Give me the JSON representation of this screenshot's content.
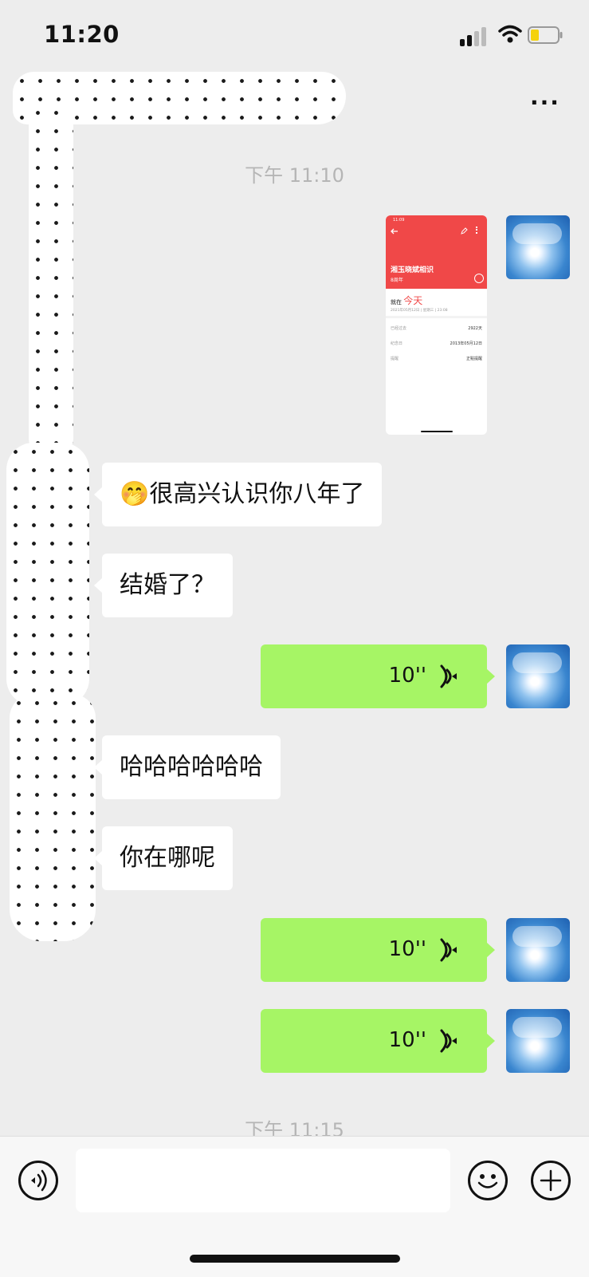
{
  "status_bar": {
    "time": "11:20"
  },
  "header": {
    "more_label": "···"
  },
  "timestamps": [
    "下午 11:10",
    "下午 11:15"
  ],
  "shared_card": {
    "status_time": "11:09",
    "title": "湘玉晓斌相识",
    "subtitle": "8周年",
    "today_prefix": "就在",
    "today_word": "今天",
    "date_line": "2021年05月12日 | 星期三 | 23:08",
    "rows": [
      {
        "label": "已经过去",
        "value": "2922天"
      },
      {
        "label": "纪念日",
        "value": "2013年05月12日"
      },
      {
        "label": "提醒",
        "value": "正點提醒"
      }
    ]
  },
  "messages": [
    {
      "side": "left",
      "type": "text",
      "emoji": "🤭",
      "text": "很高兴认识你八年了"
    },
    {
      "side": "left",
      "type": "text",
      "text": "结婚了？"
    },
    {
      "side": "right",
      "type": "voice",
      "duration": "10''"
    },
    {
      "side": "left",
      "type": "text",
      "text": "哈哈哈哈哈哈"
    },
    {
      "side": "left",
      "type": "text",
      "text": "你在哪呢"
    },
    {
      "side": "right",
      "type": "voice",
      "duration": "10''"
    },
    {
      "side": "right",
      "type": "voice",
      "duration": "10''"
    }
  ],
  "icons": {
    "voice_toggle": "voice-mode-icon",
    "emoji": "smiley-icon",
    "add": "plus-icon",
    "more": "ellipsis-icon"
  },
  "colors": {
    "background": "#ededed",
    "voice_bubble": "#a6f565",
    "card_header": "#f04848"
  }
}
